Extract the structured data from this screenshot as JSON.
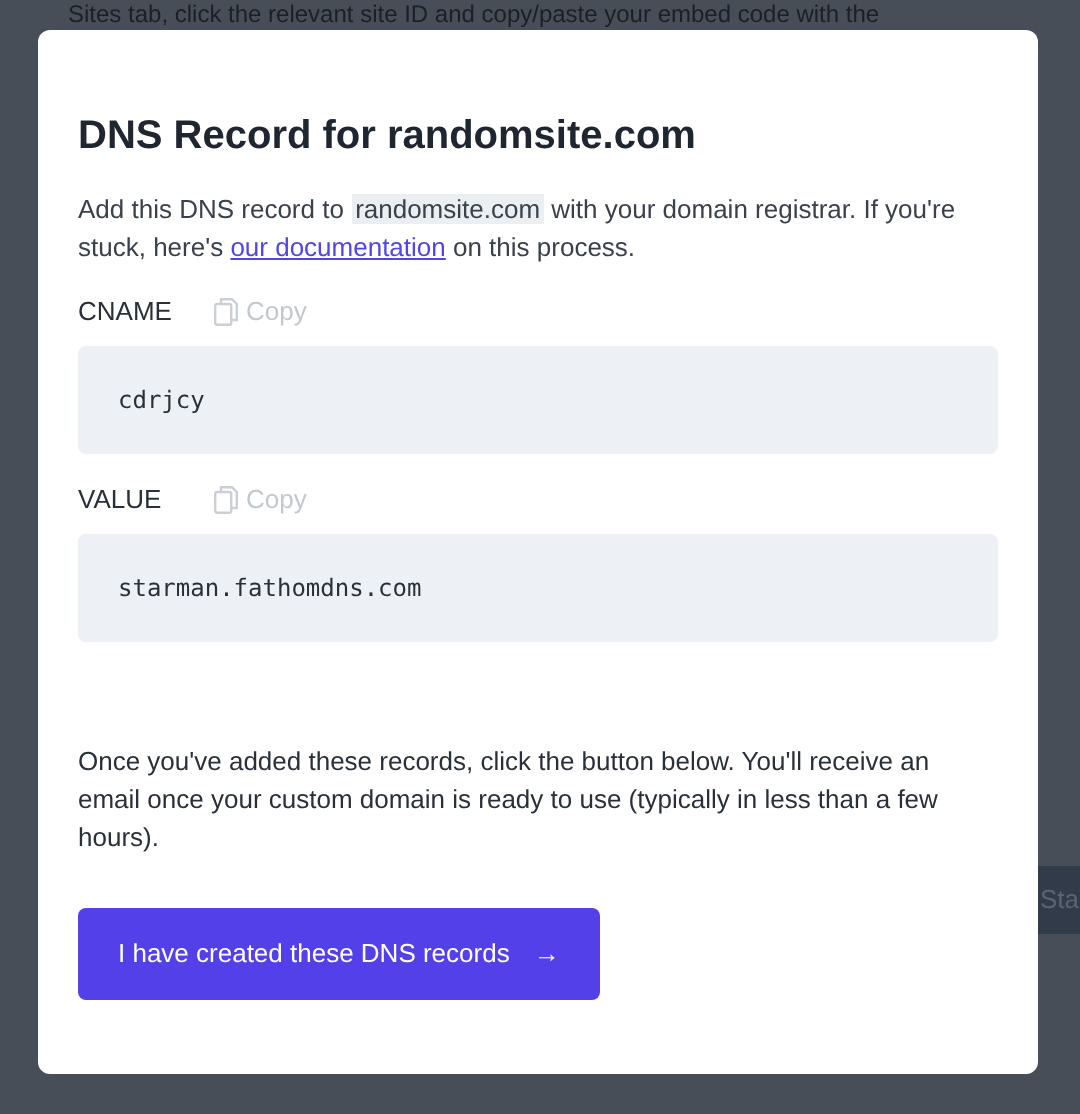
{
  "background": {
    "text_lines": [
      "Sites tab, click the relevant site ID and copy/paste your embed code with the"
    ],
    "button_fragment": "Sta"
  },
  "dialog": {
    "title": "DNS Record for randomsite.com",
    "intro": {
      "before": "Add this DNS record to ",
      "domain": "randomsite.com",
      "middle": " with your domain registrar. If you're stuck, here's ",
      "link": "our documentation",
      "after": " on this process."
    },
    "records": [
      {
        "label": "CNAME",
        "copy_label": "Copy",
        "value": "cdrjcy"
      },
      {
        "label": "VALUE",
        "copy_label": "Copy",
        "value": "starman.fathomdns.com"
      }
    ],
    "note": "Once you've added these records, click the button below. You'll receive an email once your custom domain is ready to use (typically in less than a few hours).",
    "button": {
      "label": "I have created these DNS records",
      "arrow": "→"
    }
  }
}
